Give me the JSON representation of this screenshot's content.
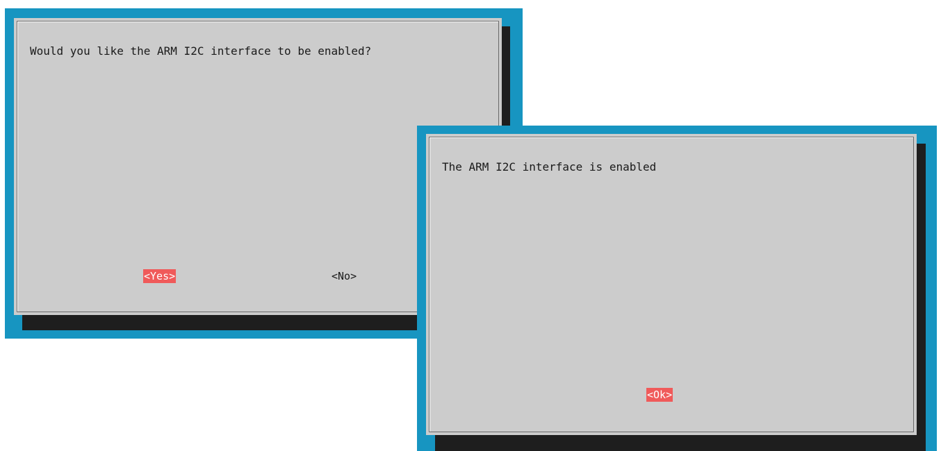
{
  "colors": {
    "terminal_bg": "#1795c1",
    "dialog_bg": "#cccccc",
    "shadow": "#1e1e1e",
    "button_highlight": "#f05a5a"
  },
  "dialog_left": {
    "message": "Would you like the ARM I2C interface to be enabled?",
    "yes_label": "<Yes>",
    "no_label": "<No>",
    "selected": "yes"
  },
  "dialog_right": {
    "message": "The ARM I2C interface is enabled",
    "ok_label": "<Ok>",
    "selected": "ok"
  }
}
